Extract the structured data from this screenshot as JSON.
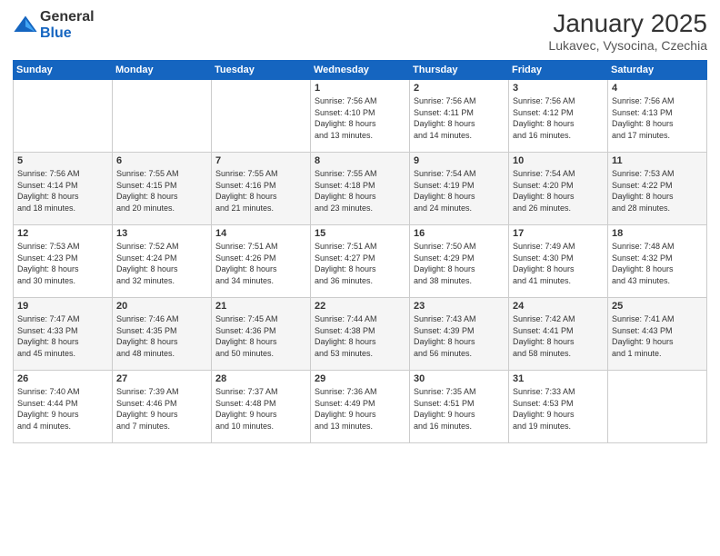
{
  "logo": {
    "general": "General",
    "blue": "Blue"
  },
  "header": {
    "month": "January 2025",
    "location": "Lukavec, Vysocina, Czechia"
  },
  "weekdays": [
    "Sunday",
    "Monday",
    "Tuesday",
    "Wednesday",
    "Thursday",
    "Friday",
    "Saturday"
  ],
  "weeks": [
    [
      {
        "day": "",
        "info": ""
      },
      {
        "day": "",
        "info": ""
      },
      {
        "day": "",
        "info": ""
      },
      {
        "day": "1",
        "info": "Sunrise: 7:56 AM\nSunset: 4:10 PM\nDaylight: 8 hours\nand 13 minutes."
      },
      {
        "day": "2",
        "info": "Sunrise: 7:56 AM\nSunset: 4:11 PM\nDaylight: 8 hours\nand 14 minutes."
      },
      {
        "day": "3",
        "info": "Sunrise: 7:56 AM\nSunset: 4:12 PM\nDaylight: 8 hours\nand 16 minutes."
      },
      {
        "day": "4",
        "info": "Sunrise: 7:56 AM\nSunset: 4:13 PM\nDaylight: 8 hours\nand 17 minutes."
      }
    ],
    [
      {
        "day": "5",
        "info": "Sunrise: 7:56 AM\nSunset: 4:14 PM\nDaylight: 8 hours\nand 18 minutes."
      },
      {
        "day": "6",
        "info": "Sunrise: 7:55 AM\nSunset: 4:15 PM\nDaylight: 8 hours\nand 20 minutes."
      },
      {
        "day": "7",
        "info": "Sunrise: 7:55 AM\nSunset: 4:16 PM\nDaylight: 8 hours\nand 21 minutes."
      },
      {
        "day": "8",
        "info": "Sunrise: 7:55 AM\nSunset: 4:18 PM\nDaylight: 8 hours\nand 23 minutes."
      },
      {
        "day": "9",
        "info": "Sunrise: 7:54 AM\nSunset: 4:19 PM\nDaylight: 8 hours\nand 24 minutes."
      },
      {
        "day": "10",
        "info": "Sunrise: 7:54 AM\nSunset: 4:20 PM\nDaylight: 8 hours\nand 26 minutes."
      },
      {
        "day": "11",
        "info": "Sunrise: 7:53 AM\nSunset: 4:22 PM\nDaylight: 8 hours\nand 28 minutes."
      }
    ],
    [
      {
        "day": "12",
        "info": "Sunrise: 7:53 AM\nSunset: 4:23 PM\nDaylight: 8 hours\nand 30 minutes."
      },
      {
        "day": "13",
        "info": "Sunrise: 7:52 AM\nSunset: 4:24 PM\nDaylight: 8 hours\nand 32 minutes."
      },
      {
        "day": "14",
        "info": "Sunrise: 7:51 AM\nSunset: 4:26 PM\nDaylight: 8 hours\nand 34 minutes."
      },
      {
        "day": "15",
        "info": "Sunrise: 7:51 AM\nSunset: 4:27 PM\nDaylight: 8 hours\nand 36 minutes."
      },
      {
        "day": "16",
        "info": "Sunrise: 7:50 AM\nSunset: 4:29 PM\nDaylight: 8 hours\nand 38 minutes."
      },
      {
        "day": "17",
        "info": "Sunrise: 7:49 AM\nSunset: 4:30 PM\nDaylight: 8 hours\nand 41 minutes."
      },
      {
        "day": "18",
        "info": "Sunrise: 7:48 AM\nSunset: 4:32 PM\nDaylight: 8 hours\nand 43 minutes."
      }
    ],
    [
      {
        "day": "19",
        "info": "Sunrise: 7:47 AM\nSunset: 4:33 PM\nDaylight: 8 hours\nand 45 minutes."
      },
      {
        "day": "20",
        "info": "Sunrise: 7:46 AM\nSunset: 4:35 PM\nDaylight: 8 hours\nand 48 minutes."
      },
      {
        "day": "21",
        "info": "Sunrise: 7:45 AM\nSunset: 4:36 PM\nDaylight: 8 hours\nand 50 minutes."
      },
      {
        "day": "22",
        "info": "Sunrise: 7:44 AM\nSunset: 4:38 PM\nDaylight: 8 hours\nand 53 minutes."
      },
      {
        "day": "23",
        "info": "Sunrise: 7:43 AM\nSunset: 4:39 PM\nDaylight: 8 hours\nand 56 minutes."
      },
      {
        "day": "24",
        "info": "Sunrise: 7:42 AM\nSunset: 4:41 PM\nDaylight: 8 hours\nand 58 minutes."
      },
      {
        "day": "25",
        "info": "Sunrise: 7:41 AM\nSunset: 4:43 PM\nDaylight: 9 hours\nand 1 minute."
      }
    ],
    [
      {
        "day": "26",
        "info": "Sunrise: 7:40 AM\nSunset: 4:44 PM\nDaylight: 9 hours\nand 4 minutes."
      },
      {
        "day": "27",
        "info": "Sunrise: 7:39 AM\nSunset: 4:46 PM\nDaylight: 9 hours\nand 7 minutes."
      },
      {
        "day": "28",
        "info": "Sunrise: 7:37 AM\nSunset: 4:48 PM\nDaylight: 9 hours\nand 10 minutes."
      },
      {
        "day": "29",
        "info": "Sunrise: 7:36 AM\nSunset: 4:49 PM\nDaylight: 9 hours\nand 13 minutes."
      },
      {
        "day": "30",
        "info": "Sunrise: 7:35 AM\nSunset: 4:51 PM\nDaylight: 9 hours\nand 16 minutes."
      },
      {
        "day": "31",
        "info": "Sunrise: 7:33 AM\nSunset: 4:53 PM\nDaylight: 9 hours\nand 19 minutes."
      },
      {
        "day": "",
        "info": ""
      }
    ]
  ]
}
